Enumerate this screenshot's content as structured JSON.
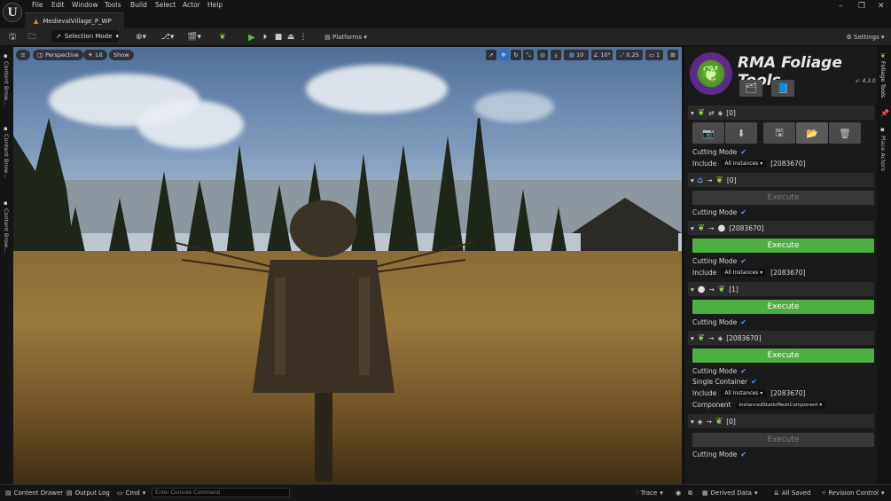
{
  "app": {
    "logo": "U",
    "document_tab": "MedievalVillage_P_WP"
  },
  "menu": [
    "File",
    "Edit",
    "Window",
    "Tools",
    "Build",
    "Select",
    "Actor",
    "Help"
  ],
  "toolbar": {
    "mode": "Selection Mode",
    "platforms": "Platforms",
    "settings": "Settings"
  },
  "viewport": {
    "perspective": "Perspective",
    "lit": "Lit",
    "show": "Show",
    "grid_snap": "10",
    "rot_snap": "10°",
    "scale_snap": "0.25",
    "camera_speed": "1"
  },
  "side_tabs": {
    "left": [
      "Content Brow…",
      "Content Brow…",
      "Content Brow…"
    ],
    "right": [
      "Foliage Tools",
      "Place Actors"
    ]
  },
  "panel": {
    "title": "RMA Foliage Tools",
    "version": "v: 4.3.0",
    "sections": [
      {
        "id": "leaf-swap-box",
        "count": "[0]",
        "rows": [
          {
            "label": "Cutting Mode",
            "checked": true
          },
          {
            "label": "Include",
            "dropdown": "All Instances",
            "value": "[2083670]"
          }
        ]
      },
      {
        "id": "house-to-leaf",
        "count": "[0]",
        "button": "Execute",
        "enabled": false,
        "rows": [
          {
            "label": "Cutting Mode",
            "checked": true
          }
        ]
      },
      {
        "id": "leaf-to-sphere",
        "count": "[2083670]",
        "button": "Execute",
        "enabled": true,
        "rows": [
          {
            "label": "Cutting Mode",
            "checked": true
          },
          {
            "label": "Include",
            "dropdown": "All Instances",
            "value": "[2083670]"
          }
        ]
      },
      {
        "id": "sphere-to-leaf",
        "count": "[1]",
        "button": "Execute",
        "enabled": true,
        "rows": [
          {
            "label": "Cutting Mode",
            "checked": true
          }
        ]
      },
      {
        "id": "leaf-to-mesh",
        "count": "[2083670]",
        "button": "Execute",
        "enabled": true,
        "rows": [
          {
            "label": "Cutting Mode",
            "checked": true
          },
          {
            "label": "Single Container",
            "checked": true
          },
          {
            "label": "Include",
            "dropdown": "All Instances",
            "value": "[2083670]"
          },
          {
            "label": "Component",
            "dropdown": "InstancedStaticMeshComponent"
          }
        ]
      },
      {
        "id": "mesh-to-leaf",
        "count": "[0]",
        "button": "Execute",
        "enabled": false,
        "rows": [
          {
            "label": "Cutting Mode",
            "checked": true
          }
        ]
      }
    ]
  },
  "status": {
    "content_drawer": "Content Drawer",
    "output_log": "Output Log",
    "cmd": "Cmd",
    "console_placeholder": "Enter Console Command",
    "trace": "Trace",
    "derived_data": "Derived Data",
    "all_saved": "All Saved",
    "revision_control": "Revision Control"
  },
  "colors": {
    "accent_green": "#4caf3f",
    "leaf_green": "#8fd14f",
    "logo_purple": "#5d2a8a"
  }
}
